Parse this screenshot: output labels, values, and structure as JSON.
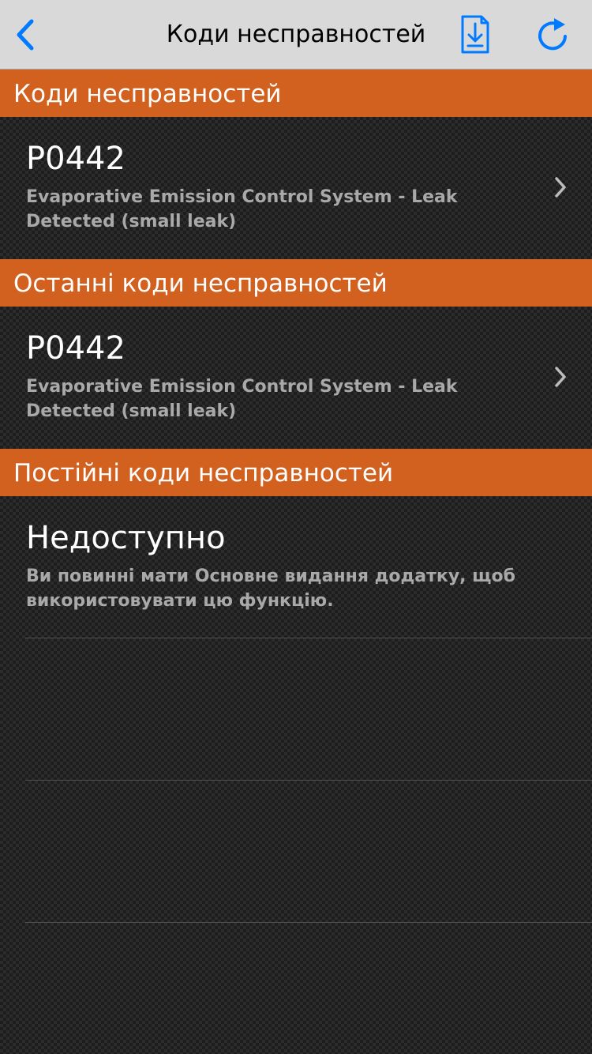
{
  "navbar": {
    "title": "Коди несправностей",
    "back_icon": "chevron-left-icon",
    "download_icon": "download-document-icon",
    "refresh_icon": "refresh-icon"
  },
  "sections": [
    {
      "header": "Коди несправностей",
      "rows": [
        {
          "code": "P0442",
          "description": "Evaporative Emission Control System - Leak Detected (small leak)"
        }
      ]
    },
    {
      "header": "Останні коди несправностей",
      "rows": [
        {
          "code": "P0442",
          "description": "Evaporative Emission Control System - Leak Detected (small leak)"
        }
      ]
    },
    {
      "header": "Постійні коди несправностей",
      "rows": [
        {
          "code": "Недоступно",
          "description": "Ви повинні мати Основне видання додатку, щоб використовувати цю функцію."
        }
      ]
    }
  ],
  "colors": {
    "accent": "#007aff",
    "section_header": "#d2601f",
    "navbar": "#d9d9d9"
  }
}
